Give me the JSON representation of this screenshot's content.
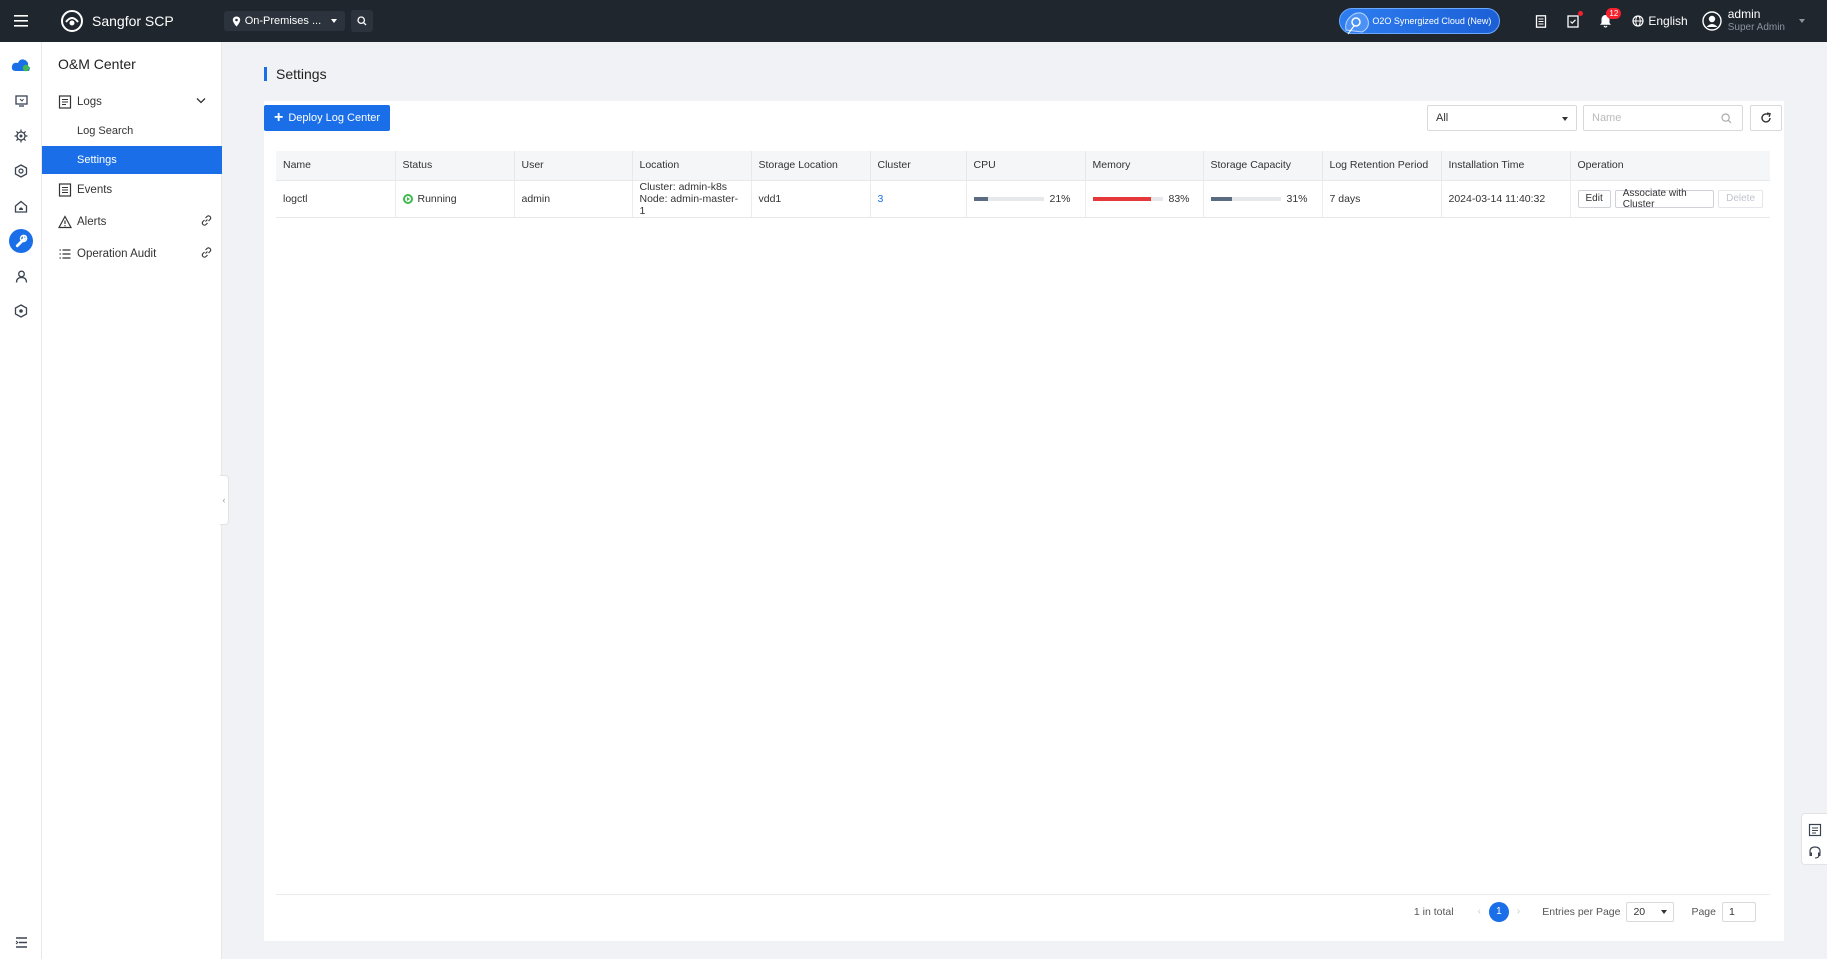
{
  "app": {
    "title": "Sangfor SCP",
    "region": "On-Premises ...",
    "o2o_label": "O2O Synergized Cloud (New)",
    "notification_count": "12",
    "language": "English",
    "user_name": "admin",
    "user_role": "Super Admin"
  },
  "rail": {
    "items": [
      "cloud-icon",
      "monitor-icon",
      "gear-cluster-icon",
      "network-icon",
      "home-cloud-icon",
      "wrench-icon",
      "user-icon",
      "hex-settings-icon"
    ],
    "active": "wrench-icon",
    "bottom": "collapse-menu-icon"
  },
  "subnav": {
    "title": "O&M Center",
    "logs": "Logs",
    "log_search": "Log Search",
    "settings": "Settings",
    "events": "Events",
    "alerts": "Alerts",
    "operation_audit": "Operation Audit"
  },
  "page": {
    "title": "Settings",
    "deploy_button": "Deploy Log Center",
    "filter_value": "All",
    "name_placeholder": "Name"
  },
  "table": {
    "columns": [
      "Name",
      "Status",
      "User",
      "Location",
      "Storage Location",
      "Cluster",
      "CPU",
      "Memory",
      "Storage Capacity",
      "Log Retention Period",
      "Installation Time",
      "Operation"
    ],
    "rows": [
      {
        "name": "logctl",
        "status": "Running",
        "user": "admin",
        "location_cluster": "Cluster: admin-k8s",
        "location_node": "Node: admin-master-1",
        "storage_location": "vdd1",
        "cluster": "3",
        "cpu": "21%",
        "cpu_value": 0.21,
        "memory": "83%",
        "memory_value": 0.83,
        "storage_capacity": "31%",
        "storage_value": 0.31,
        "retention": "7 days",
        "installed": "2024-03-14 11:40:32",
        "op_edit": "Edit",
        "op_associate": "Associate with Cluster",
        "op_delete": "Delete"
      }
    ]
  },
  "pagination": {
    "total": "1 in total",
    "current_page": "1",
    "entries_label": "Entries per Page",
    "entries_value": "20",
    "page_label": "Page",
    "page_value": "1"
  },
  "colors": {
    "accent": "#1a6fe8",
    "topbar": "#20262e",
    "bar_normal": "#5b6b82",
    "bar_warning": "#e5383b",
    "running": "#3fb950"
  }
}
